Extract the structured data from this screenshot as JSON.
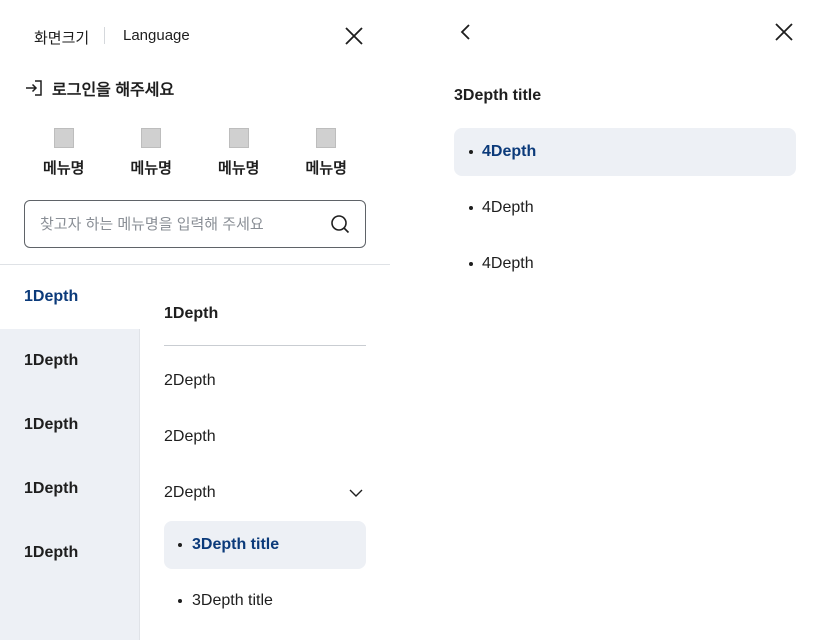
{
  "left_panel": {
    "utility": {
      "screen_size": "화면크기",
      "language": "Language"
    },
    "close_icon": "close-icon",
    "login": {
      "icon": "login-icon",
      "label": "로그인을 해주세요"
    },
    "quick_menu": [
      {
        "label": "메뉴명",
        "icon": "placeholder-icon"
      },
      {
        "label": "메뉴명",
        "icon": "placeholder-icon"
      },
      {
        "label": "메뉴명",
        "icon": "placeholder-icon"
      },
      {
        "label": "메뉴명",
        "icon": "placeholder-icon"
      }
    ],
    "search": {
      "placeholder": "찾고자 하는 메뉴명을 입력해 주세요",
      "value": "",
      "icon": "search-icon"
    },
    "depth1": [
      {
        "label": "1Depth",
        "active": true
      },
      {
        "label": "1Depth",
        "active": false
      },
      {
        "label": "1Depth",
        "active": false
      },
      {
        "label": "1Depth",
        "active": false
      },
      {
        "label": "1Depth",
        "active": false
      }
    ],
    "depth2": {
      "title": "1Depth",
      "items": [
        {
          "label": "2Depth"
        },
        {
          "label": "2Depth"
        },
        {
          "label": "2Depth",
          "expanded": true,
          "icon": "chevron-down-icon"
        }
      ],
      "depth3": [
        {
          "label": "3Depth title",
          "active": true
        },
        {
          "label": "3Depth title",
          "active": false
        }
      ]
    }
  },
  "right_panel": {
    "back_icon": "chevron-left-icon",
    "close_icon": "close-icon",
    "title": "3Depth title",
    "items": [
      {
        "label": "4Depth",
        "active": true
      },
      {
        "label": "4Depth",
        "active": false
      },
      {
        "label": "4Depth",
        "active": false
      }
    ]
  },
  "colors": {
    "accent_text": "#0b3a7a",
    "active_bg": "#edf0f5",
    "text": "#1e1e1e"
  }
}
